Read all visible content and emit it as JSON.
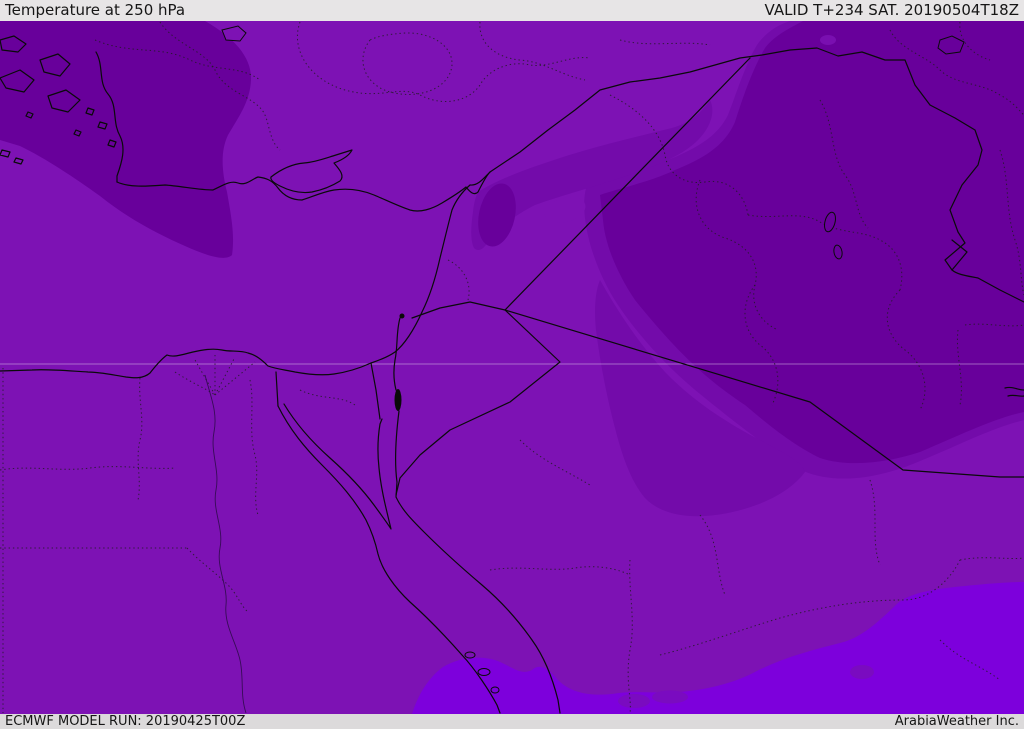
{
  "header": {
    "title": "Temperature at 250 hPa",
    "valid": "VALID T+234 SAT. 20190504T18Z"
  },
  "footer": {
    "model_run": "ECMWF MODEL RUN: 20190425T00Z",
    "brand": "ArabiaWeather Inc."
  },
  "map": {
    "colors": {
      "base": "#7D12B4",
      "band_mid": "#730BAA",
      "band_dark": "#68009B",
      "band_bright": "#7D00DC",
      "oval_in_bright": "#7A0BC0",
      "water": "#0a0a0a"
    }
  }
}
